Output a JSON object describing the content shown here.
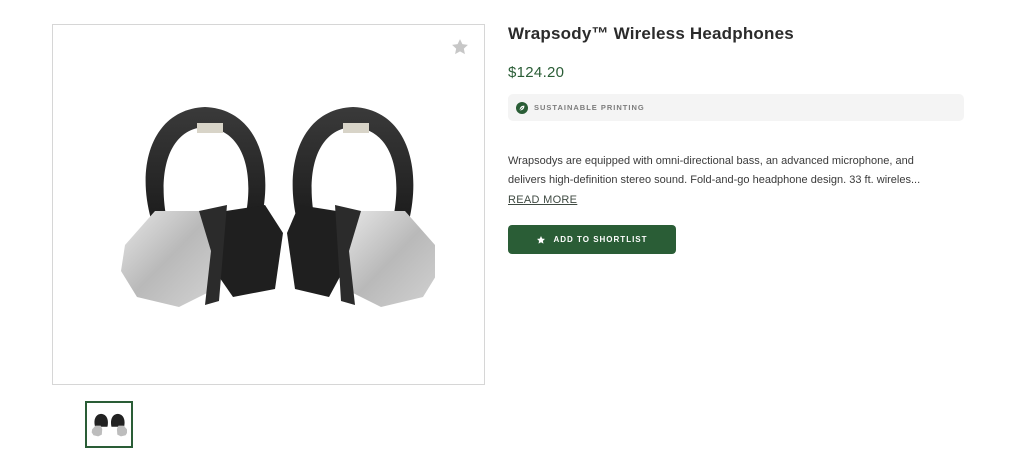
{
  "product": {
    "title": "Wrapsody™ Wireless Headphones",
    "price": "$124.20",
    "badge": {
      "label": "SUSTAINABLE PRINTING",
      "icon": "leaf-icon"
    },
    "description_lines": [
      "Wrapsodys are equipped with omni-directional bass, an advanced microphone, and",
      "delivers high-definition stereo sound. Fold-and-go headphone design. 33 ft. wireles..."
    ],
    "read_more_label": "READ MORE",
    "shortlist_button": {
      "label": "ADD TO SHORTLIST",
      "icon": "star-icon"
    },
    "favorite_icon": "star-icon"
  },
  "gallery": {
    "main_image": "headphones-image",
    "thumbnails": [
      "headphones-thumbnail"
    ]
  },
  "colors": {
    "brand_green": "#2a5d36",
    "price_green": "#2a5d36",
    "badge_bg": "#f4f4f4",
    "favorite_star": "#c7c7c7"
  }
}
